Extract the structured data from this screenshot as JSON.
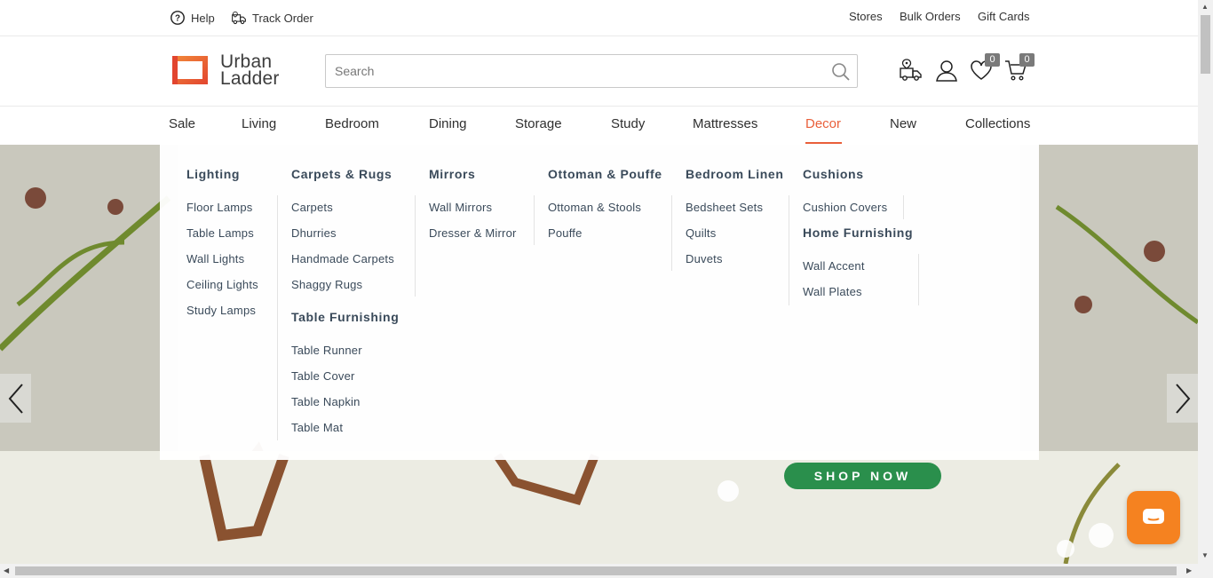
{
  "topbar": {
    "help": "Help",
    "track_order": "Track Order",
    "stores": "Stores",
    "bulk_orders": "Bulk Orders",
    "gift_cards": "Gift Cards"
  },
  "header": {
    "logo_line1": "Urban",
    "logo_line2": "Ladder",
    "search_placeholder": "Search",
    "wishlist_count": "0",
    "cart_count": "0"
  },
  "nav": {
    "items": [
      "Sale",
      "Living",
      "Bedroom",
      "Dining",
      "Storage",
      "Study",
      "Mattresses",
      "Decor",
      "New",
      "Collections"
    ],
    "active": "Decor"
  },
  "mega_menu": {
    "lighting": {
      "title": "Lighting",
      "links": [
        "Floor Lamps",
        "Table Lamps",
        "Wall Lights",
        "Ceiling Lights",
        "Study Lamps"
      ]
    },
    "carpets": {
      "title": "Carpets & Rugs",
      "links": [
        "Carpets",
        "Dhurries",
        "Handmade Carpets",
        "Shaggy Rugs"
      ]
    },
    "table_furnishing": {
      "title": "Table Furnishing",
      "links": [
        "Table Runner",
        "Table Cover",
        "Table Napkin",
        "Table Mat"
      ]
    },
    "mirrors": {
      "title": "Mirrors",
      "links": [
        "Wall Mirrors",
        "Dresser & Mirror"
      ]
    },
    "ottoman": {
      "title": "Ottoman & Pouffe",
      "links": [
        "Ottoman & Stools",
        "Pouffe"
      ]
    },
    "bedroom_linen": {
      "title": "Bedroom Linen",
      "links": [
        "Bedsheet Sets",
        "Quilts",
        "Duvets"
      ]
    },
    "cushions": {
      "title": "Cushions",
      "links": [
        "Cushion Covers"
      ]
    },
    "home_furnishing": {
      "title": "Home Furnishing",
      "links": [
        "Wall Accent",
        "Wall Plates"
      ]
    }
  },
  "hero": {
    "cta": "SHOP NOW"
  },
  "colors": {
    "accent": "#e95f3a",
    "cta_green": "#2a8f4c",
    "chat_orange": "#f58220"
  }
}
